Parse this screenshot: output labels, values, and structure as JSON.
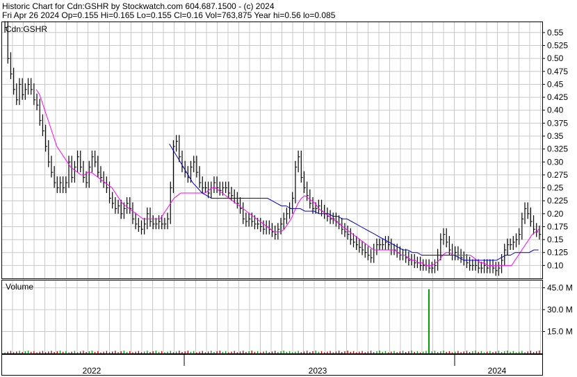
{
  "header": {
    "line1": "Historic Chart for Cdn:GSHR by Stockwatch.com 604.687.1500 - (c) 2024",
    "line2": "Fri Apr 26 2024   Op=0.155  Hi=0.165  Lo=0.155  Cl=0.16  Vol=763,875  Year hi=0.56  lo=0.085"
  },
  "chart_data": [
    {
      "type": "line",
      "title": "Cdn:GSHR",
      "ylim": [
        0.075,
        0.57
      ],
      "y_ticks": [
        "0.55",
        "0.525",
        "0.50",
        "0.475",
        "0.45",
        "0.425",
        "0.40",
        "0.375",
        "0.35",
        "0.325",
        "0.30",
        "0.275",
        "0.25",
        "0.225",
        "0.20",
        "0.175",
        "0.15",
        "0.125",
        "0.10"
      ],
      "x_tick_labels": [
        "2022",
        "2023",
        "2024"
      ],
      "colors": {
        "price": "#000000",
        "ma_short": "#ff00ff",
        "ma_long": "#0000cc",
        "grid": "#c8c8c8"
      },
      "series": [
        {
          "values": [
            0.56,
            0.5,
            0.47,
            0.44,
            0.42,
            0.45,
            0.43,
            0.44,
            0.45,
            0.44,
            0.42,
            0.41,
            0.38,
            0.36,
            0.33,
            0.3,
            0.28,
            0.26,
            0.25,
            0.26,
            0.25,
            0.26,
            0.3,
            0.27,
            0.29,
            0.31,
            0.29,
            0.27,
            0.26,
            0.29,
            0.31,
            0.3,
            0.28,
            0.27,
            0.26,
            0.25,
            0.23,
            0.22,
            0.21,
            0.215,
            0.2,
            0.21,
            0.22,
            0.21,
            0.19,
            0.18,
            0.175,
            0.17,
            0.18,
            0.2,
            0.185,
            0.18,
            0.18,
            0.185,
            0.18,
            0.18,
            0.19,
            0.25,
            0.33,
            0.34,
            0.31,
            0.29,
            0.28,
            0.27,
            0.29,
            0.3,
            0.28,
            0.26,
            0.25,
            0.25,
            0.24,
            0.25,
            0.26,
            0.25,
            0.245,
            0.25,
            0.25,
            0.24,
            0.235,
            0.23,
            0.22,
            0.21,
            0.19,
            0.185,
            0.19,
            0.185,
            0.18,
            0.18,
            0.175,
            0.17,
            0.175,
            0.17,
            0.165,
            0.16,
            0.17,
            0.18,
            0.19,
            0.2,
            0.21,
            0.23,
            0.29,
            0.31,
            0.27,
            0.25,
            0.235,
            0.22,
            0.21,
            0.21,
            0.215,
            0.205,
            0.2,
            0.195,
            0.19,
            0.19,
            0.185,
            0.18,
            0.17,
            0.165,
            0.16,
            0.15,
            0.145,
            0.14,
            0.135,
            0.13,
            0.125,
            0.12,
            0.115,
            0.13,
            0.14,
            0.14,
            0.14,
            0.145,
            0.14,
            0.13,
            0.13,
            0.125,
            0.12,
            0.12,
            0.115,
            0.11,
            0.11,
            0.105,
            0.105,
            0.1,
            0.1,
            0.1,
            0.095,
            0.095,
            0.1,
            0.12,
            0.15,
            0.16,
            0.145,
            0.13,
            0.12,
            0.125,
            0.12,
            0.115,
            0.11,
            0.105,
            0.1,
            0.1,
            0.1,
            0.095,
            0.095,
            0.1,
            0.095,
            0.1,
            0.095,
            0.09,
            0.095,
            0.11,
            0.13,
            0.14,
            0.14,
            0.145,
            0.15,
            0.16,
            0.19,
            0.21,
            0.2,
            0.185,
            0.17,
            0.165,
            0.16
          ]
        },
        {
          "values": [
            null,
            null,
            null,
            null,
            null,
            null,
            null,
            null,
            null,
            0.44,
            0.43,
            0.41,
            0.39,
            0.37,
            0.35,
            0.33,
            0.32,
            0.31,
            0.3,
            0.29,
            0.285,
            0.28,
            0.275,
            0.275,
            0.28,
            0.28,
            0.275,
            0.27,
            0.265,
            0.26,
            0.255,
            0.25,
            0.24,
            0.23,
            0.22,
            0.215,
            0.21,
            0.205,
            0.2,
            0.195,
            0.19,
            0.19,
            0.19,
            0.19,
            0.19,
            0.19,
            0.2,
            0.21,
            0.22,
            0.23,
            0.235,
            0.24,
            0.24,
            0.24,
            0.24,
            0.24,
            0.24,
            0.24,
            0.24,
            0.245,
            0.25,
            0.25,
            0.245,
            0.24,
            0.235,
            0.23,
            0.225,
            0.22,
            0.215,
            0.21,
            0.205,
            0.2,
            0.195,
            0.19,
            0.185,
            0.18,
            0.175,
            0.17,
            0.165,
            0.165,
            0.165,
            0.17,
            0.18,
            0.19,
            0.205,
            0.22,
            0.23,
            0.235,
            0.23,
            0.225,
            0.22,
            0.21,
            0.205,
            0.2,
            0.195,
            0.19,
            0.185,
            0.18,
            0.175,
            0.17,
            0.165,
            0.16,
            0.155,
            0.15,
            0.145,
            0.14,
            0.135,
            0.13,
            0.13,
            0.13,
            0.13,
            0.13,
            0.13,
            0.13,
            0.125,
            0.12,
            0.12,
            0.115,
            0.11,
            0.11,
            0.105,
            0.105,
            0.1,
            0.1,
            0.1,
            0.105,
            0.11,
            0.12,
            0.125,
            0.125,
            0.12,
            0.12,
            0.12,
            0.12,
            0.12,
            0.12,
            0.115,
            0.11,
            0.105,
            0.105,
            0.1,
            0.1,
            0.1,
            0.1,
            0.1,
            0.1,
            0.1,
            0.1,
            0.11,
            0.12,
            0.13,
            0.14,
            0.15,
            0.16,
            0.165,
            0.17
          ]
        },
        {
          "values": [
            null,
            null,
            null,
            null,
            null,
            null,
            null,
            null,
            null,
            null,
            null,
            null,
            null,
            null,
            null,
            null,
            null,
            null,
            null,
            null,
            null,
            null,
            null,
            null,
            null,
            null,
            null,
            null,
            null,
            null,
            null,
            null,
            null,
            null,
            null,
            0.335,
            0.32,
            0.305,
            0.29,
            0.275,
            0.26,
            0.25,
            0.24,
            0.235,
            0.23,
            0.23,
            0.23,
            0.23,
            0.23,
            0.23,
            0.23,
            0.23,
            0.23,
            0.23,
            0.23,
            0.23,
            0.23,
            0.225,
            0.22,
            0.215,
            0.215,
            0.21,
            0.21,
            0.21,
            0.205,
            0.205,
            0.205,
            0.2,
            0.2,
            0.2,
            0.195,
            0.195,
            0.19,
            0.19,
            0.185,
            0.18,
            0.175,
            0.17,
            0.165,
            0.16,
            0.155,
            0.15,
            0.145,
            0.14,
            0.135,
            0.13,
            0.13,
            0.125,
            0.125,
            0.12,
            0.12,
            0.12,
            0.12,
            0.12,
            0.12,
            0.12,
            0.12,
            0.115,
            0.11,
            0.11,
            0.11,
            0.11,
            0.11,
            0.11,
            0.11,
            0.11,
            0.115,
            0.12,
            0.12,
            0.125,
            0.125,
            0.125,
            0.125,
            0.13,
            0.13
          ]
        }
      ]
    },
    {
      "type": "bar",
      "title": "Volume",
      "ylim": [
        0,
        50
      ],
      "y_ticks": [
        "45.0 M",
        "30.0 M",
        "15.0 M"
      ],
      "x_tick_labels": [
        "2022",
        "2023",
        "2024"
      ],
      "colors": {
        "up": "#00a000",
        "down": "#cc0000"
      },
      "spike": {
        "value": 44,
        "color": "#00a000"
      }
    }
  ]
}
